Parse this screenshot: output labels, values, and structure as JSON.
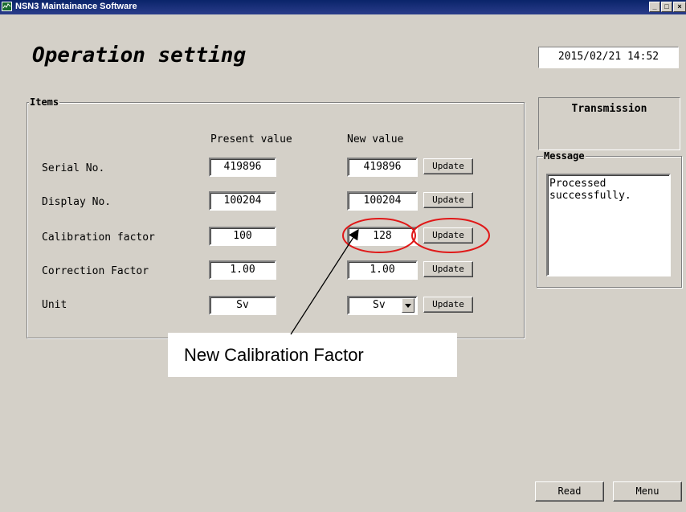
{
  "window": {
    "title": "NSN3 Maintainance Software",
    "min_label": "_",
    "max_label": "□",
    "close_label": "×"
  },
  "page_title": "Operation setting",
  "datetime": "2015/02/21 14:52",
  "items_group": {
    "label": "Items",
    "col_present": "Present value",
    "col_new": "New value",
    "update_label": "Update",
    "rows": [
      {
        "label": "Serial No.",
        "present": "419896",
        "new": "419896"
      },
      {
        "label": "Display No.",
        "present": "100204",
        "new": "100204"
      },
      {
        "label": "Calibration factor",
        "present": "100",
        "new": "128"
      },
      {
        "label": "Correction Factor",
        "present": "1.00",
        "new": "1.00"
      },
      {
        "label": "Unit",
        "present": "Sv",
        "new": "Sv"
      }
    ]
  },
  "transmission": {
    "label": "Transmission"
  },
  "message": {
    "label": "Message",
    "text": "Processed successfully."
  },
  "buttons": {
    "read": "Read",
    "menu": "Menu"
  },
  "annotation": {
    "text": "New Calibration Factor",
    "highlight_color": "#e01818"
  }
}
